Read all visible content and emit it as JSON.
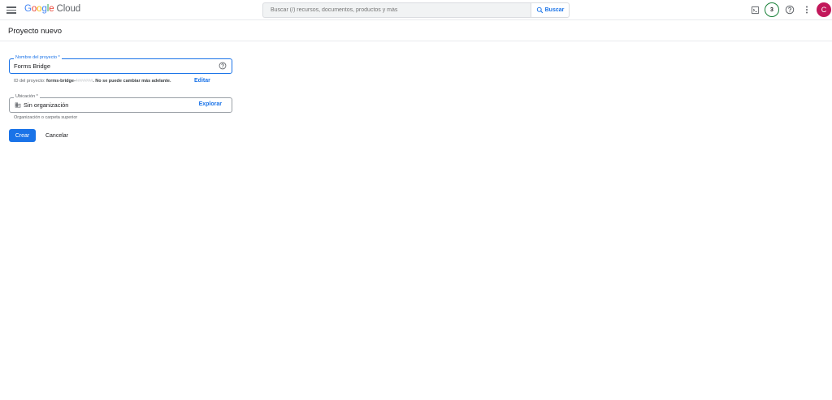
{
  "header": {
    "logo_google": "Google",
    "logo_cloud": "Cloud",
    "search_placeholder": "Buscar (/) recursos, documentos, productos y más",
    "search_button_label": "Buscar",
    "notifications_count": "3",
    "avatar_initial": "C",
    "icons": [
      "menu-icon",
      "search-icon",
      "cloud-shell-icon",
      "help-icon",
      "more-vert-icon"
    ]
  },
  "page": {
    "title": "Proyecto nuevo"
  },
  "form": {
    "project_name_label": "Nombre del proyecto *",
    "project_name_value": "Forms Bridge",
    "project_id_prefix": "ID del proyecto: ",
    "project_id_value": "forms-bridge-",
    "project_id_suffix": "4######",
    "project_id_note": ". No se puede cambiar más adelante.",
    "edit_label": "Editar",
    "location_label": "Ubicación *",
    "location_value": "Sin organización",
    "explore_label": "Explorar",
    "location_hint": "Organización o carpeta superior",
    "create_label": "Crear",
    "cancel_label": "Cancelar"
  },
  "colors": {
    "accent": "#1a73e8",
    "badge_ring": "#188038",
    "avatar_bg": "#c2185b"
  }
}
